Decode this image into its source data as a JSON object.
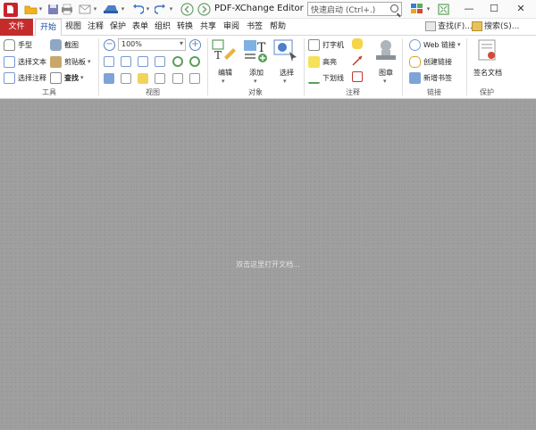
{
  "window": {
    "title": "PDF-XChange Editor",
    "search_placeholder": "快速启动 (Ctrl+.)",
    "minimize": "—",
    "maximize": "☐",
    "close": "✕"
  },
  "menu": {
    "file": "文件",
    "tabs": [
      "开始",
      "视图",
      "注释",
      "保护",
      "表单",
      "组织",
      "转换",
      "共享",
      "审阅",
      "书签",
      "帮助"
    ],
    "active_tab": "开始",
    "find": "查找(F)...",
    "search": "搜索(S)..."
  },
  "ribbon": {
    "tools": {
      "label": "工具",
      "hand": "手型",
      "select_text": "选择文本",
      "select_annotation": "选择注释",
      "snapshot": "截图",
      "clipboard": "剪贴板",
      "find": "查找"
    },
    "view": {
      "label": "视图",
      "zoom": "100%"
    },
    "objects": {
      "label": "对象",
      "edit": "编辑",
      "add": "添加",
      "select": "选择"
    },
    "comment": {
      "label": "注释",
      "typewriter": "打字机",
      "highlight": "高亮",
      "underline": "下划线",
      "stamp": "图章"
    },
    "links": {
      "label": "链接",
      "web_links": "Web 链接",
      "create_link": "创建链接",
      "new_bookmark": "新增书签"
    },
    "protect": {
      "label": "保护",
      "sign": "签名文档"
    }
  },
  "document": {
    "hint": "双击这里打开文档..."
  },
  "colors": {
    "file_tab": "#c42c2c",
    "doc_background": "#9d9d9d",
    "accent": "#1a4fa0"
  }
}
